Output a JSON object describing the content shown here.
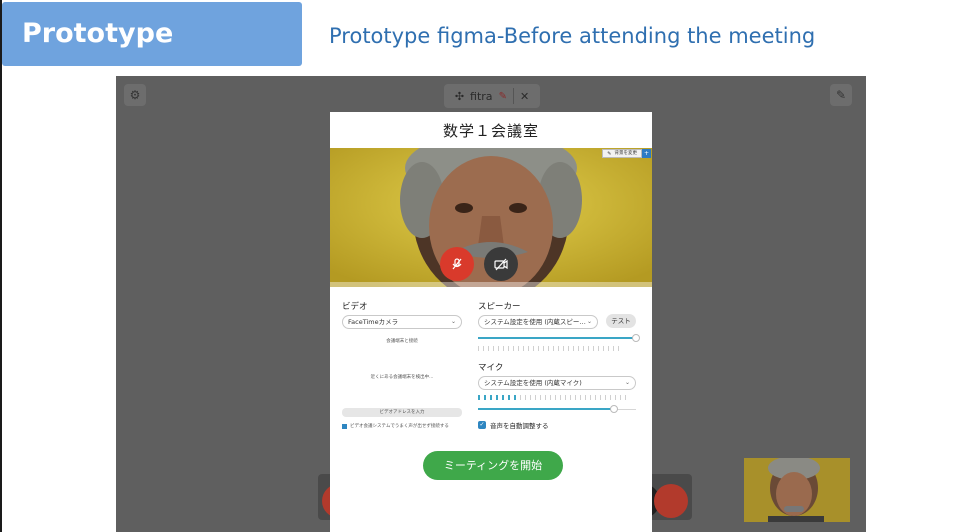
{
  "slide": {
    "badge": "Prototype",
    "subtitle": "Prototype figma-Before attending the meeting"
  },
  "app": {
    "toolbar": {
      "brand": "fitra"
    }
  },
  "modal": {
    "title": "数学１会議室",
    "bg_chip_label": "背景を変更",
    "video_section_label": "ビデオ",
    "camera_select": "FaceTimeカメラ",
    "video_tiny_label": "会議端末と接続",
    "video_tiny_status": "近くにある会議端末を検出中...",
    "video_tiny_addr_button": "ビデオアドレスを入力",
    "video_tiny_checkbox": "ビデオ会議システムでうまく声が出せず接続する",
    "speaker_section_label": "スピーカー",
    "speaker_select": "システム設定を使用 (内蔵スピー…",
    "test_button": "テスト",
    "speaker_volume": 1.0,
    "mic_section_label": "マイク",
    "mic_select": "システム設定を使用 (内蔵マイク)",
    "mic_level": 0.25,
    "mic_volume": 0.86,
    "auto_adjust_label": "音声を自動調整する",
    "auto_adjust_checked": true,
    "start_button": "ミーティングを開始"
  },
  "colors": {
    "badge_bg": "#6fa3de",
    "subtitle": "#2f6fb0",
    "mic_off": "#d93a2b",
    "start_button": "#3fa84a",
    "accent": "#3aa6c6"
  },
  "icons": [
    "settings-icon",
    "pencil-icon",
    "mic-muted-icon",
    "camera-off-icon",
    "pin-icon",
    "check-icon",
    "chevron-down-icon"
  ]
}
